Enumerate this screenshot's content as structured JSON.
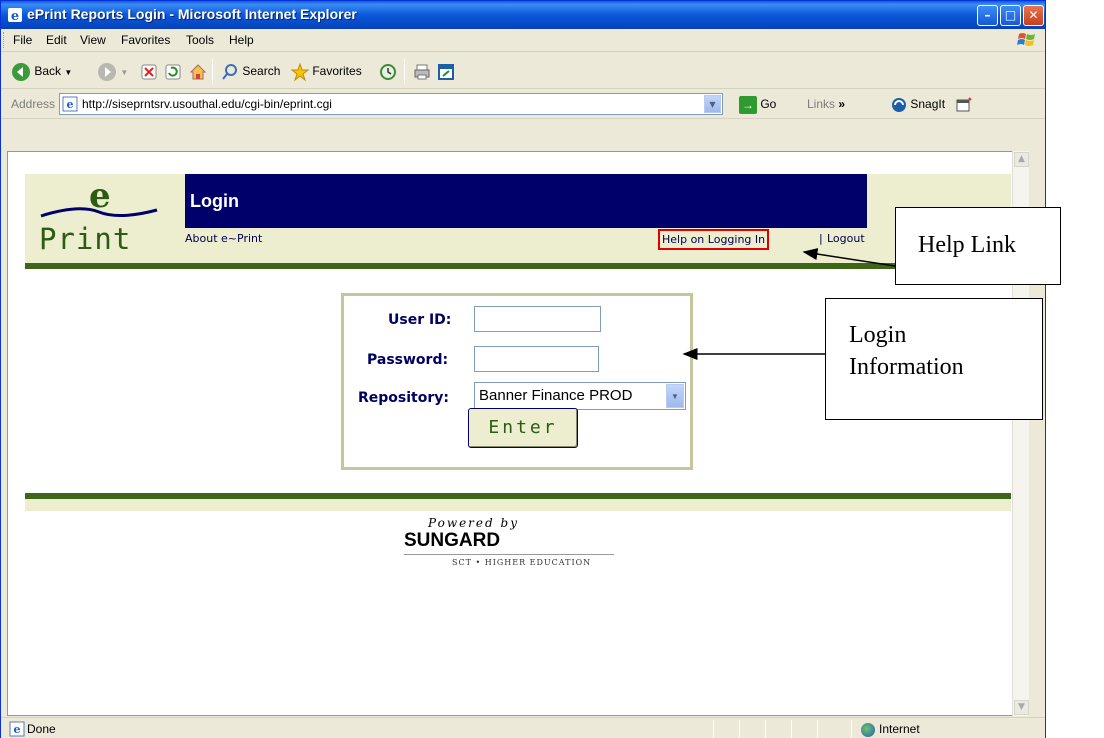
{
  "window": {
    "title": "ePrint Reports Login - Microsoft Internet Explorer",
    "controls": {
      "minimize": "–",
      "maximize": "□",
      "close": "✕"
    }
  },
  "menubar": {
    "items": [
      "File",
      "Edit",
      "View",
      "Favorites",
      "Tools",
      "Help"
    ]
  },
  "toolbar": {
    "back_label": "Back",
    "search_label": "Search",
    "favorites_label": "Favorites"
  },
  "address": {
    "label": "Address",
    "url": "http://siseprntsrv.usouthal.edu/cgi-bin/eprint.cgi",
    "go_label": "Go",
    "links_label": "Links",
    "snagit_label": "SnagIt"
  },
  "page": {
    "logo_e": "e",
    "logo_print": "Print",
    "banner_title": "Login",
    "about_link": "About e~Print",
    "help_link": "Help on Logging In",
    "separator": "|",
    "logout_link": "Logout",
    "form": {
      "user_id_label": "User ID:",
      "user_id_value": "",
      "password_label": "Password:",
      "password_value": "",
      "repository_label": "Repository:",
      "repository_value": "Banner Finance PROD",
      "enter_label": "Enter"
    },
    "powered_by": "Powered by",
    "brand": "SUNGARD",
    "brand_sub": "SCT • HIGHER EDUCATION"
  },
  "statusbar": {
    "status": "Done",
    "zone": "Internet"
  },
  "callouts": {
    "help": "Help Link",
    "login_line1": "Login",
    "login_line2": "Information"
  },
  "colors": {
    "banner": "#00006b",
    "header_bg": "#ededcf",
    "green_rule": "#3d6618",
    "help_highlight": "#e00000"
  }
}
